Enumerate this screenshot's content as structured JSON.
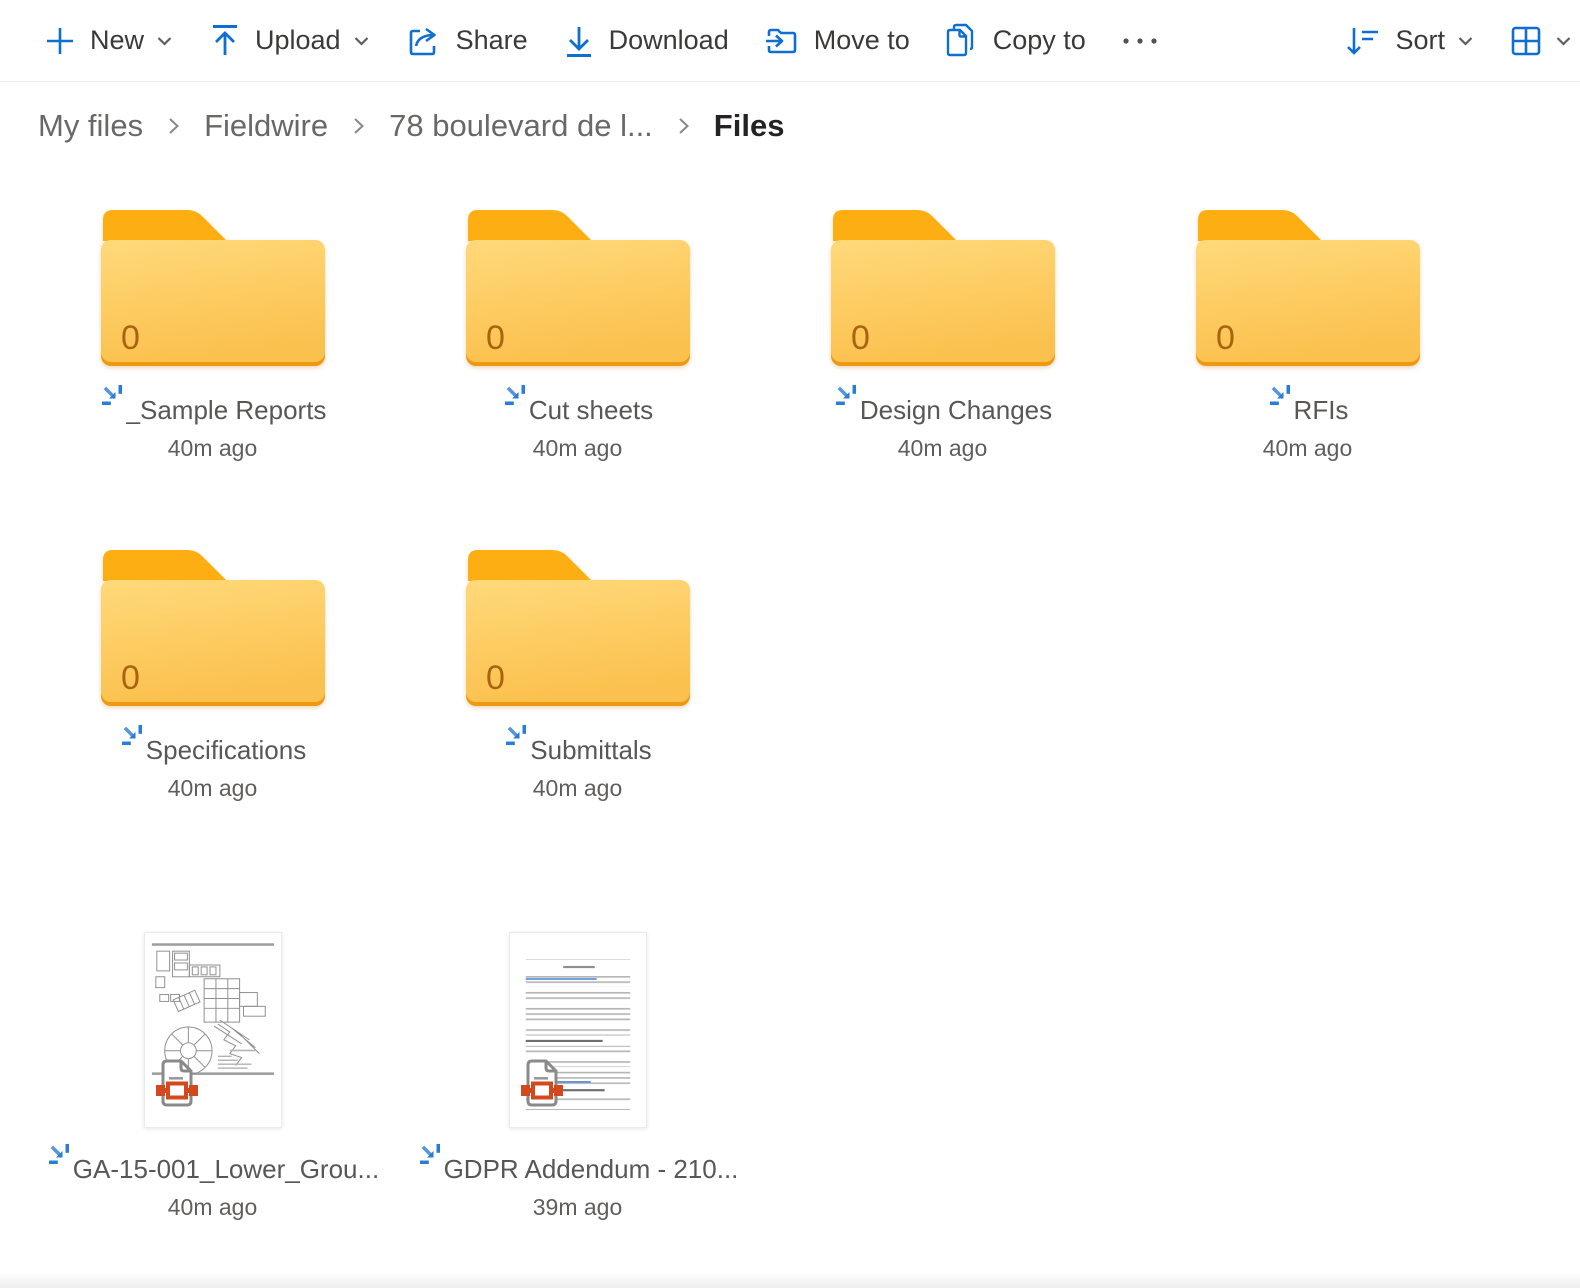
{
  "toolbar": {
    "left": [
      {
        "label": "New",
        "icon": "plus-icon",
        "chevron": true
      },
      {
        "label": "Upload",
        "icon": "upload-icon",
        "chevron": true
      },
      {
        "label": "Share",
        "icon": "share-icon",
        "chevron": false
      },
      {
        "label": "Download",
        "icon": "download-icon",
        "chevron": false
      },
      {
        "label": "Move to",
        "icon": "move-to-icon",
        "chevron": false
      },
      {
        "label": "Copy to",
        "icon": "copy-to-icon",
        "chevron": false
      },
      {
        "label": "",
        "icon": "more-icon",
        "chevron": false
      }
    ],
    "right": [
      {
        "label": "Sort",
        "icon": "sort-icon",
        "chevron": true
      },
      {
        "label": "",
        "icon": "grid-view-icon",
        "chevron": true
      }
    ]
  },
  "breadcrumb": {
    "items": [
      {
        "label": "My files"
      },
      {
        "label": "Fieldwire"
      },
      {
        "label": "78 boulevard de l..."
      },
      {
        "label": "Files",
        "current": true
      }
    ]
  },
  "folders": [
    {
      "name": "_Sample Reports",
      "count": "0",
      "modified": "40m ago"
    },
    {
      "name": "Cut sheets",
      "count": "0",
      "modified": "40m ago"
    },
    {
      "name": "Design Changes",
      "count": "0",
      "modified": "40m ago"
    },
    {
      "name": "RFIs",
      "count": "0",
      "modified": "40m ago"
    },
    {
      "name": "Specifications",
      "count": "0",
      "modified": "40m ago"
    },
    {
      "name": "Submittals",
      "count": "0",
      "modified": "40m ago"
    }
  ],
  "files": [
    {
      "name": "GA-15-001_Lower_Grou...",
      "modified": "40m ago",
      "thumbnail": "floor-plan",
      "type": "pdf"
    },
    {
      "name": "GDPR Addendum - 210...",
      "modified": "39m ago",
      "thumbnail": "text-document",
      "type": "pdf"
    }
  ],
  "colors": {
    "accent_blue": "#0f6fd1",
    "folder_tab": "#fcae13",
    "folder_body_top": "#ffd97a",
    "folder_body_bottom": "#fbc14e",
    "folder_lip": "#ee9910",
    "folder_count": "#ab6310",
    "pdf_badge_red": "#d1491c",
    "toolbar_text": "#3b3a39",
    "breadcrumb_text": "#6a6867",
    "breadcrumb_current": "#242322"
  }
}
